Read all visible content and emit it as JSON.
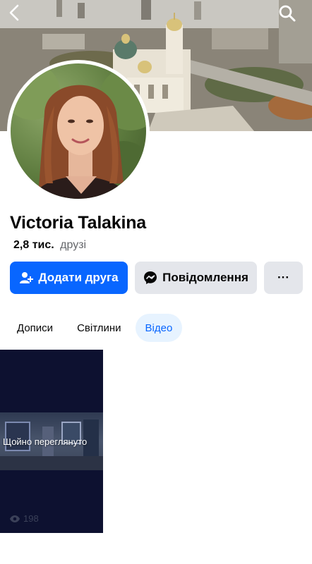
{
  "nav": {
    "back_icon": "chevron-left-icon",
    "search_icon": "search-icon"
  },
  "profile": {
    "name": "Victoria Talakina",
    "friends_count": "2,8 тис.",
    "friends_label": "друзі"
  },
  "actions": {
    "add_friend_label": "Додати друга",
    "add_friend_icon": "add-person-icon",
    "message_label": "Повідомлення",
    "message_icon": "messenger-icon",
    "more_label": "···"
  },
  "tabs": [
    {
      "label": "Дописи",
      "active": false
    },
    {
      "label": "Світлини",
      "active": false
    },
    {
      "label": "Відео",
      "active": true
    }
  ],
  "videos": [
    {
      "status_label": "Щойно переглянуто",
      "views": "198"
    }
  ],
  "colors": {
    "primary": "#0866ff",
    "secondary_bg": "#e4e6eb",
    "active_tab_bg": "#e7f3ff",
    "muted_text": "#65676b"
  }
}
